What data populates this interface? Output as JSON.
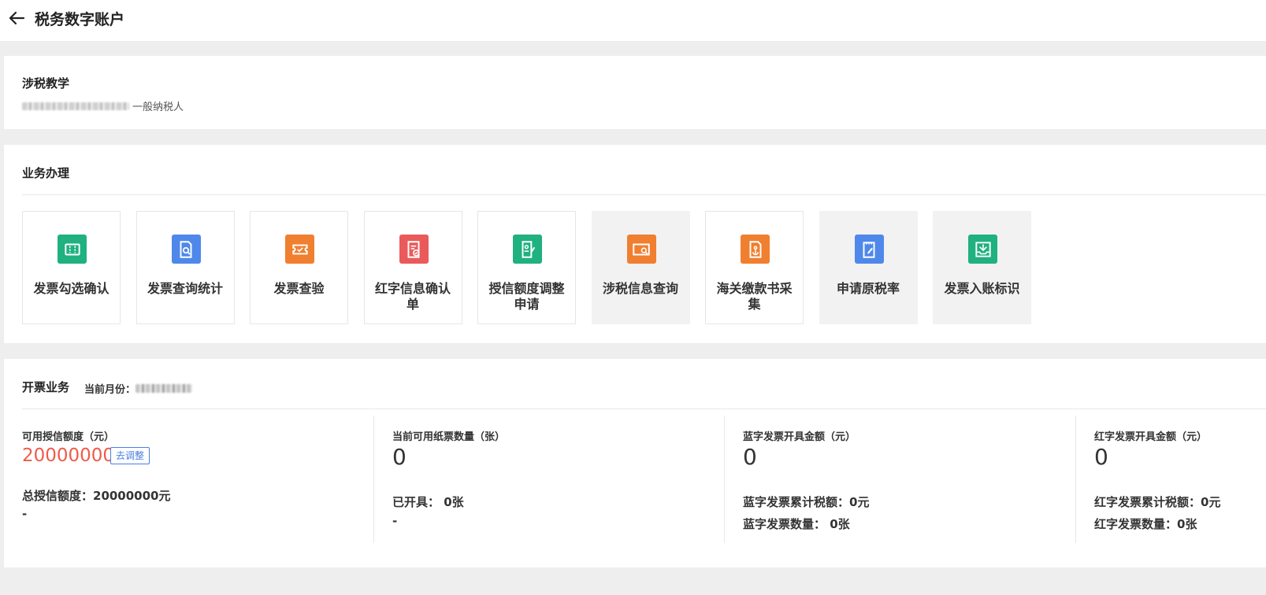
{
  "header": {
    "title": "税务数字账户"
  },
  "company": {
    "name": "涉税教学",
    "taxpayer_type": "一般纳税人"
  },
  "business": {
    "title": "业务办理",
    "tiles": [
      {
        "label": "发票勾选确认",
        "icon": "ticket-icon",
        "color": "#1fb17f",
        "shaded": false
      },
      {
        "label": "发票查询统计",
        "icon": "doc-search-icon",
        "color": "#4f88ea",
        "shaded": false
      },
      {
        "label": "发票查验",
        "icon": "ticket-check-icon",
        "color": "#f07f2f",
        "shaded": false
      },
      {
        "label": "红字信息确认单",
        "icon": "doc-check-icon",
        "color": "#ea5a5a",
        "shaded": false
      },
      {
        "label": "授信额度调整申请",
        "icon": "doc-edit-icon",
        "color": "#1fb17f",
        "shaded": false
      },
      {
        "label": "涉税信息查询",
        "icon": "card-search-icon",
        "color": "#f07f2f",
        "shaded": true
      },
      {
        "label": "海关缴款书采集",
        "icon": "anchor-doc-icon",
        "color": "#f07f2f",
        "shaded": false
      },
      {
        "label": "申请原税率",
        "icon": "pad-edit-icon",
        "color": "#4f88ea",
        "shaded": true
      },
      {
        "label": "发票入账标识",
        "icon": "inbox-icon",
        "color": "#1fb17f",
        "shaded": true
      }
    ]
  },
  "invoice": {
    "title": "开票业务",
    "month_label": "当前月份：",
    "credit": {
      "label": "可用授信额度（元）",
      "value": "20000000",
      "adjust": "去调整",
      "total": "总授信额度：20000000元",
      "extra": "-"
    },
    "paper": {
      "label": "当前可用纸票数量（张）",
      "value": "0",
      "issued": "已开具：  0张",
      "extra": "-"
    },
    "blue": {
      "label": "蓝字发票开具金额（元）",
      "value": "0",
      "tax": "蓝字发票累计税额：0元",
      "count": "蓝字发票数量：  0张"
    },
    "red": {
      "label": "红字发票开具金额（元）",
      "value": "0",
      "tax": "红字发票累计税额：0元",
      "count": "红字发票数量：0张"
    }
  }
}
